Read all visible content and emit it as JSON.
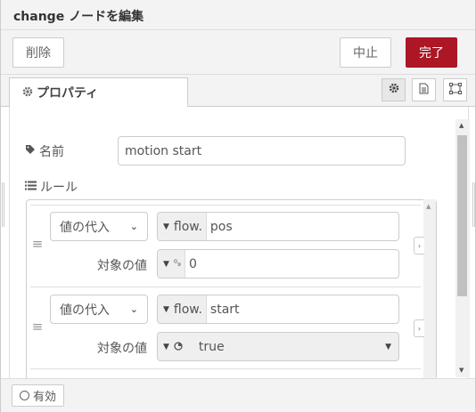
{
  "header": {
    "title": "change ノードを編集"
  },
  "toolbar": {
    "delete_label": "削除",
    "cancel_label": "中止",
    "done_label": "完了",
    "done_color": "#ad1625"
  },
  "tabs": {
    "properties": {
      "label": "プロパティ",
      "icon": "gear-icon"
    },
    "icons": [
      "settings-icon",
      "description-icon",
      "appearance-icon"
    ]
  },
  "form": {
    "name": {
      "label": "名前",
      "icon": "tag-icon",
      "value": "motion start"
    },
    "rules_label": "ルール",
    "rules_icon": "list-icon"
  },
  "rules": [
    {
      "action": "値の代入",
      "target_type": "flow.",
      "target": "pos",
      "value_label": "対象の値",
      "value_type": "number-icon",
      "value": "0"
    },
    {
      "action": "値の代入",
      "target_type": "flow.",
      "target": "start",
      "value_label": "対象の値",
      "value_type": "boolean-icon",
      "value": "true"
    }
  ],
  "footer": {
    "enabled_label": "有効"
  }
}
